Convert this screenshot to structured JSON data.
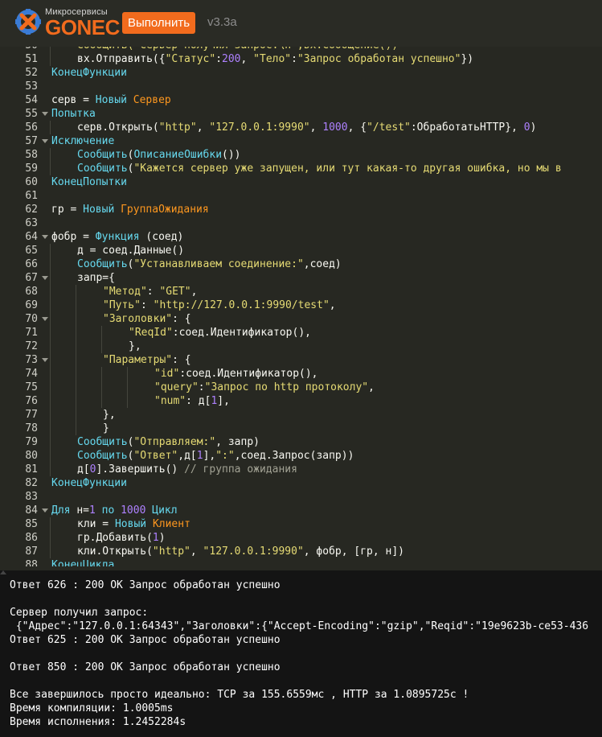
{
  "header": {
    "logo_small": "Микросервисы",
    "logo_big": "GONEC",
    "run_label": "Выполнить",
    "version": "v3.3a"
  },
  "editor": {
    "lines": [
      {
        "n": "50",
        "ind": 2,
        "t": [
          [
            "Сообщить(\"Сервер получил запрос:\\n\",вх.Сообщение())",
            "s"
          ]
        ]
      },
      {
        "n": "51",
        "ind": 2,
        "t": [
          [
            "вх.Отправить({",
            ""
          ],
          [
            "\"Статус\"",
            "s"
          ],
          [
            ":",
            ""
          ],
          [
            "200",
            "n"
          ],
          [
            ", ",
            ""
          ],
          [
            "\"Тело\"",
            "s"
          ],
          [
            ":",
            ""
          ],
          [
            "\"Запрос обработан успешно\"",
            "s"
          ],
          [
            "})",
            ""
          ]
        ]
      },
      {
        "n": "52",
        "ind": 1,
        "t": [
          [
            "КонецФункции",
            "k"
          ]
        ]
      },
      {
        "n": "53",
        "ind": 0,
        "t": []
      },
      {
        "n": "54",
        "ind": 1,
        "t": [
          [
            "серв = ",
            ""
          ],
          [
            "Новый ",
            "k"
          ],
          [
            "Сервер",
            "t"
          ]
        ]
      },
      {
        "n": "55",
        "ind": 1,
        "t": [
          [
            "Попытка",
            "k"
          ]
        ]
      },
      {
        "n": "56",
        "ind": 2,
        "t": [
          [
            "серв.Открыть(",
            ""
          ],
          [
            "\"http\"",
            "s"
          ],
          [
            ", ",
            ""
          ],
          [
            "\"127.0.0.1:9990\"",
            "s"
          ],
          [
            ", ",
            ""
          ],
          [
            "1000",
            "n"
          ],
          [
            ", {",
            ""
          ],
          [
            "\"/test\"",
            "s"
          ],
          [
            ":ОбработатьHTTP}, ",
            ""
          ],
          [
            "0",
            "n"
          ],
          [
            ")",
            ""
          ]
        ]
      },
      {
        "n": "57",
        "ind": 1,
        "t": [
          [
            "Исключение",
            "k"
          ]
        ]
      },
      {
        "n": "58",
        "ind": 2,
        "t": [
          [
            "Сообщить",
            "k"
          ],
          [
            "(",
            ""
          ],
          [
            "ОписаниеОшибки",
            "k"
          ],
          [
            "())",
            ""
          ]
        ]
      },
      {
        "n": "59",
        "ind": 2,
        "t": [
          [
            "Сообщить",
            "k"
          ],
          [
            "(",
            ""
          ],
          [
            "\"Кажется сервер уже запущен, или тут какая-то другая ошибка, но мы в",
            "s"
          ]
        ]
      },
      {
        "n": "60",
        "ind": 1,
        "t": [
          [
            "КонецПопытки",
            "k"
          ]
        ]
      },
      {
        "n": "61",
        "ind": 0,
        "t": []
      },
      {
        "n": "62",
        "ind": 1,
        "t": [
          [
            "гр = ",
            ""
          ],
          [
            "Новый ",
            "k"
          ],
          [
            "ГруппаОжидания",
            "t"
          ]
        ]
      },
      {
        "n": "63",
        "ind": 0,
        "t": []
      },
      {
        "n": "64",
        "ind": 1,
        "t": [
          [
            "фобр = ",
            ""
          ],
          [
            "Функция ",
            "k"
          ],
          [
            "(соед)",
            ""
          ]
        ]
      },
      {
        "n": "65",
        "ind": 2,
        "t": [
          [
            "д = соед.Данные()",
            ""
          ]
        ]
      },
      {
        "n": "66",
        "ind": 2,
        "t": [
          [
            "Сообщить",
            "k"
          ],
          [
            "(",
            ""
          ],
          [
            "\"Устанавливаем соединение:\"",
            "s"
          ],
          [
            ",соед)",
            ""
          ]
        ]
      },
      {
        "n": "67",
        "ind": 2,
        "t": [
          [
            "запр={",
            ""
          ]
        ]
      },
      {
        "n": "68",
        "ind": 3,
        "t": [
          [
            "\"Метод\"",
            "s"
          ],
          [
            ": ",
            ""
          ],
          [
            "\"GET\"",
            "s"
          ],
          [
            ",",
            ""
          ]
        ]
      },
      {
        "n": "69",
        "ind": 3,
        "t": [
          [
            "\"Путь\"",
            "s"
          ],
          [
            ": ",
            ""
          ],
          [
            "\"http://127.0.0.1:9990/test\"",
            "s"
          ],
          [
            ",",
            ""
          ]
        ]
      },
      {
        "n": "70",
        "ind": 3,
        "t": [
          [
            "\"Заголовки\"",
            "s"
          ],
          [
            ": {",
            ""
          ]
        ]
      },
      {
        "n": "71",
        "ind": 4,
        "t": [
          [
            "\"ReqId\"",
            "s"
          ],
          [
            ":соед.Идентификатор(),",
            ""
          ]
        ]
      },
      {
        "n": "72",
        "ind": 4,
        "t": [
          [
            "},",
            ""
          ]
        ]
      },
      {
        "n": "73",
        "ind": 3,
        "t": [
          [
            "\"Параметры\"",
            "s"
          ],
          [
            ": {",
            ""
          ]
        ]
      },
      {
        "n": "74",
        "ind": 5,
        "t": [
          [
            "\"id\"",
            "s"
          ],
          [
            ":соед.Идентификатор(),",
            ""
          ]
        ]
      },
      {
        "n": "75",
        "ind": 5,
        "t": [
          [
            "\"query\"",
            "s"
          ],
          [
            ":",
            ""
          ],
          [
            "\"Запрос по http протоколу\"",
            "s"
          ],
          [
            ",",
            ""
          ]
        ]
      },
      {
        "n": "76",
        "ind": 5,
        "t": [
          [
            "\"num\"",
            "s"
          ],
          [
            ": д[",
            ""
          ],
          [
            "1",
            "n"
          ],
          [
            "],",
            ""
          ]
        ]
      },
      {
        "n": "77",
        "ind": 3,
        "t": [
          [
            "},",
            ""
          ]
        ]
      },
      {
        "n": "78",
        "ind": 3,
        "t": [
          [
            "}",
            ""
          ]
        ]
      },
      {
        "n": "79",
        "ind": 2,
        "t": [
          [
            "Сообщить",
            "k"
          ],
          [
            "(",
            ""
          ],
          [
            "\"Отправляем:\"",
            "s"
          ],
          [
            ", запр)",
            ""
          ]
        ]
      },
      {
        "n": "80",
        "ind": 2,
        "t": [
          [
            "Сообщить",
            "k"
          ],
          [
            "(",
            ""
          ],
          [
            "\"Ответ\"",
            "s"
          ],
          [
            ",д[",
            ""
          ],
          [
            "1",
            "n"
          ],
          [
            "],",
            ""
          ],
          [
            "\":\"",
            "s"
          ],
          [
            ",соед.Запрос(запр))",
            ""
          ]
        ]
      },
      {
        "n": "81",
        "ind": 2,
        "t": [
          [
            "д[",
            ""
          ],
          [
            "0",
            "n"
          ],
          [
            "].Завершить() ",
            ""
          ],
          [
            "// группа ожидания",
            "c"
          ]
        ]
      },
      {
        "n": "82",
        "ind": 1,
        "t": [
          [
            "КонецФункции",
            "k"
          ]
        ]
      },
      {
        "n": "83",
        "ind": 0,
        "t": []
      },
      {
        "n": "84",
        "ind": 1,
        "t": [
          [
            "Для ",
            "k"
          ],
          [
            "н=",
            ""
          ],
          [
            "1",
            "n"
          ],
          [
            " по ",
            "k"
          ],
          [
            "1000",
            "n"
          ],
          [
            " Цикл",
            "k"
          ]
        ]
      },
      {
        "n": "85",
        "ind": 2,
        "t": [
          [
            "кли = ",
            ""
          ],
          [
            "Новый ",
            "k"
          ],
          [
            "Клиент",
            "t"
          ]
        ]
      },
      {
        "n": "86",
        "ind": 2,
        "t": [
          [
            "гр.Добавить(",
            ""
          ],
          [
            "1",
            "n"
          ],
          [
            ")",
            ""
          ]
        ]
      },
      {
        "n": "87",
        "ind": 2,
        "t": [
          [
            "кли.Открыть(",
            ""
          ],
          [
            "\"http\"",
            "s"
          ],
          [
            ", ",
            ""
          ],
          [
            "\"127.0.0.1:9990\"",
            "s"
          ],
          [
            ", фобр, [гр, н])",
            ""
          ]
        ]
      },
      {
        "n": "88",
        "ind": 1,
        "t": [
          [
            "КонецЦикла",
            "k"
          ]
        ]
      }
    ]
  },
  "output": {
    "lines": [
      "Ответ 626 : 200 OK Запрос обработан успешно",
      "",
      "Сервер получил запрос:",
      " {\"Адрес\":\"127.0.0.1:64343\",\"Заголовки\":{\"Accept-Encoding\":\"gzip\",\"Reqid\":\"19e9623b-ce53-436",
      "Ответ 625 : 200 OK Запрос обработан успешно",
      "",
      "Ответ 850 : 200 OK Запрос обработан успешно",
      "",
      "Все завершилось просто идеально: TCP за 155.6559мс , HTTP за 1.0895725с !",
      "Время компиляции: 1.0005ms",
      "Время исполнения: 1.2452284s"
    ]
  }
}
